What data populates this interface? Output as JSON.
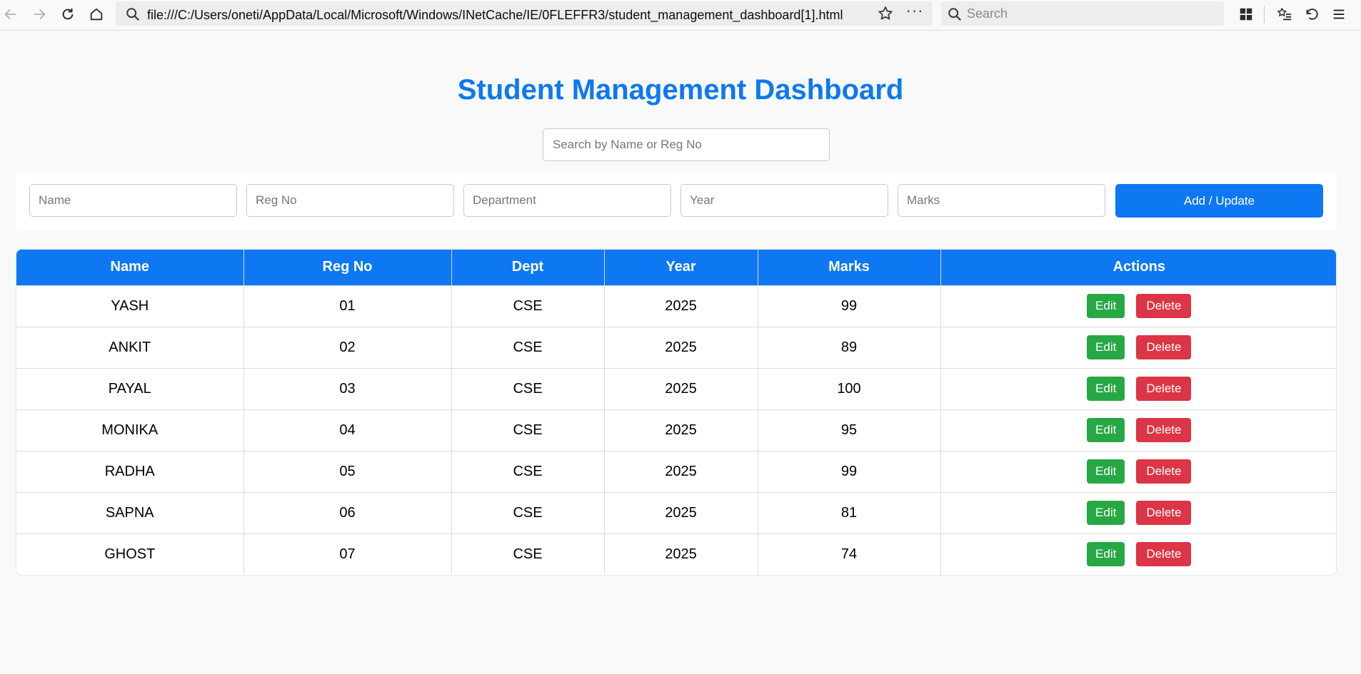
{
  "browser": {
    "url": "file:///C:/Users/oneti/AppData/Local/Microsoft/Windows/INetCache/IE/0FLEFFR3/student_management_dashboard[1].html",
    "search_placeholder": "Search",
    "more_glyph": "···"
  },
  "page": {
    "title": "Student Management Dashboard",
    "search_placeholder": "Search by Name or Reg No"
  },
  "form": {
    "name_placeholder": "Name",
    "regno_placeholder": "Reg No",
    "department_placeholder": "Department",
    "year_placeholder": "Year",
    "marks_placeholder": "Marks",
    "submit_label": "Add / Update"
  },
  "table": {
    "headers": [
      "Name",
      "Reg No",
      "Dept",
      "Year",
      "Marks",
      "Actions"
    ],
    "edit_label": "Edit",
    "delete_label": "Delete",
    "rows": [
      {
        "name": "YASH",
        "regno": "01",
        "dept": "CSE",
        "year": "2025",
        "marks": "99"
      },
      {
        "name": "ANKIT",
        "regno": "02",
        "dept": "CSE",
        "year": "2025",
        "marks": "89"
      },
      {
        "name": "PAYAL",
        "regno": "03",
        "dept": "CSE",
        "year": "2025",
        "marks": "100"
      },
      {
        "name": "MONIKA",
        "regno": "04",
        "dept": "CSE",
        "year": "2025",
        "marks": "95"
      },
      {
        "name": "RADHA",
        "regno": "05",
        "dept": "CSE",
        "year": "2025",
        "marks": "99"
      },
      {
        "name": "SAPNA",
        "regno": "06",
        "dept": "CSE",
        "year": "2025",
        "marks": "81"
      },
      {
        "name": "GHOST",
        "regno": "07",
        "dept": "CSE",
        "year": "2025",
        "marks": "74"
      }
    ]
  },
  "colors": {
    "accent": "#0d78f2",
    "edit": "#28a745",
    "delete": "#dc3545"
  }
}
